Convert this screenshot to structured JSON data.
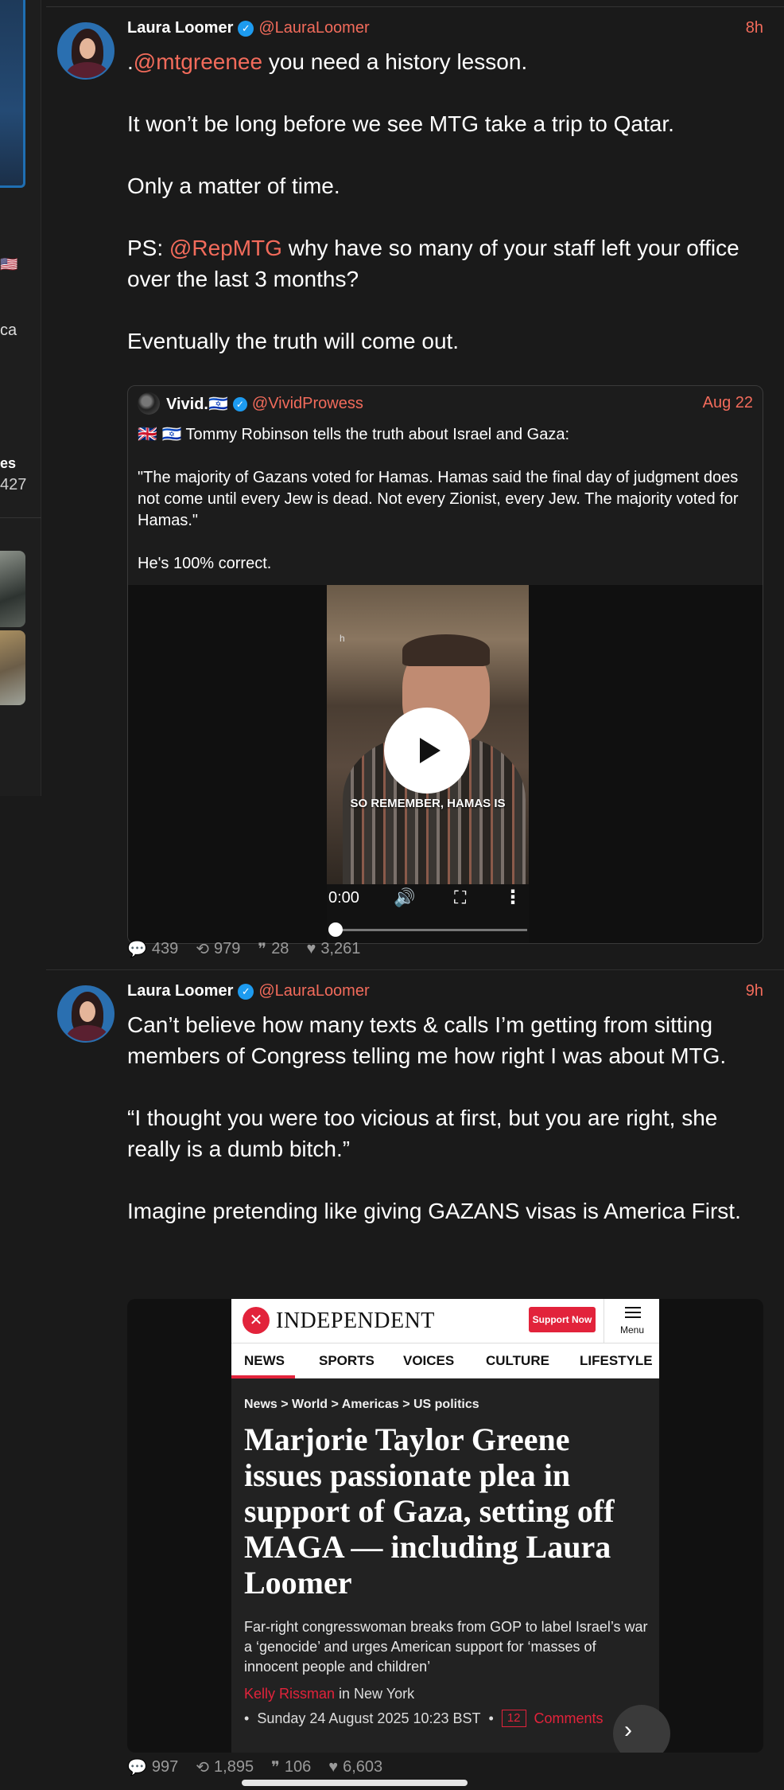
{
  "left_column": {
    "flag": "🇺🇸",
    "text_ca": "ca",
    "text_es": "es",
    "count": "427"
  },
  "posts": [
    {
      "author": "Laura Loomer",
      "handle": "@LauraLoomer",
      "time": "8h",
      "paragraphs": [
        {
          "parts": [
            {
              "t": ".",
              "m": false
            },
            {
              "t": "@mtgreenee",
              "m": true
            },
            {
              "t": " you need a history lesson.",
              "m": false
            }
          ]
        },
        {
          "parts": [
            {
              "t": "It won’t be long before we see MTG take a trip to Qatar.",
              "m": false
            }
          ]
        },
        {
          "parts": [
            {
              "t": "Only a matter of time.",
              "m": false
            }
          ]
        },
        {
          "parts": [
            {
              "t": "PS: ",
              "m": false
            },
            {
              "t": "@RepMTG",
              "m": true
            },
            {
              "t": " why have so many of your staff left your office over the last 3 months?",
              "m": false
            }
          ]
        },
        {
          "parts": [
            {
              "t": "Eventually the truth will come out.",
              "m": false
            }
          ]
        }
      ],
      "quote": {
        "author": "Vivid.🇮🇱",
        "handle": "@VividProwess",
        "time": "Aug 22",
        "line1": "🇬🇧 🇮🇱 Tommy Robinson tells the truth about Israel and Gaza:",
        "line2": "\"The majority of Gazans voted for Hamas. Hamas said the final day of judgment does not come until every Jew is dead. Not every Zionist, every Jew. The majority voted for Hamas.\"",
        "line3": "He's 100% correct.",
        "video": {
          "corner_letter": "h",
          "caption": "SO REMEMBER, HAMAS IS",
          "time": "0:00",
          "progress": 0
        }
      },
      "stats": {
        "replies": "439",
        "reposts": "979",
        "quotes": "28",
        "likes": "3,261"
      }
    },
    {
      "author": "Laura Loomer",
      "handle": "@LauraLoomer",
      "time": "9h",
      "p1": "Can’t believe how many texts & calls I’m getting from sitting members of Congress telling me how right I was about MTG.",
      "p2": "“I thought you were too vicious at first, but you are right, she really is a dumb bitch.”",
      "p3": "Imagine pretending like giving GAZANS visas is America First.",
      "article": {
        "logo": "INDEPENDENT",
        "support": "Support Now",
        "menu": "Menu",
        "nav": [
          "NEWS",
          "SPORTS",
          "VOICES",
          "CULTURE",
          "LIFESTYLE"
        ],
        "breadcrumb": "News > World > Americas > US politics",
        "headline": "Marjorie Taylor Greene issues passionate plea in support of Gaza, setting off MAGA — including Laura Loomer",
        "standfirst": "Far-right congresswoman breaks from GOP to label Israel’s war a ‘genocide’ and urges American support for ‘masses of innocent people and children’",
        "author": "Kelly Rissman",
        "location": " in New York",
        "bullet": "•",
        "date": "Sunday 24 August 2025 10:23 BST",
        "comment_count": "12",
        "comments": "Comments"
      },
      "stats": {
        "replies": "997",
        "reposts": "1,895",
        "quotes": "106",
        "likes": "6,603"
      }
    }
  ],
  "icons": {
    "reply": "💬",
    "repost": "⟲",
    "quote": "❞",
    "like": "♥",
    "verified": "✓",
    "play": "play-icon",
    "volume": "🔊",
    "fullscreen": "⛶",
    "more": "⋮",
    "next": "›"
  },
  "colors": {
    "accent": "#f26b5b",
    "verified": "#1d9bf0",
    "independent_red": "#e2233b",
    "background": "#1a1a1a"
  }
}
